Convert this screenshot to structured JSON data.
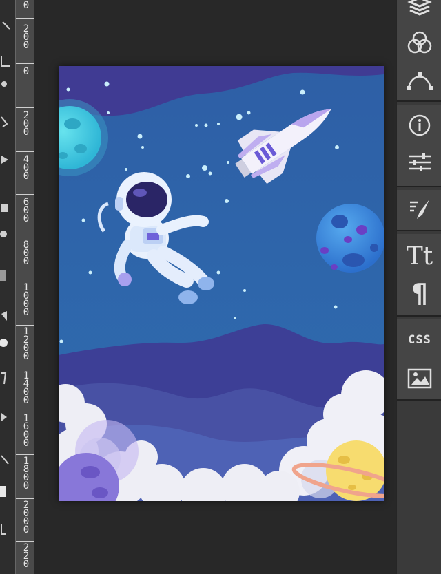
{
  "ruler": {
    "labels": [
      "0",
      "2\n0\n0",
      "0",
      "2\n0\n0",
      "4\n0\n0",
      "6\n0\n0",
      "8\n0\n0",
      "1\n0\n0\n0",
      "1\n2\n0\n0",
      "1\n4\n0\n0",
      "1\n6\n0\n0",
      "1\n8\n0\n0",
      "2\n0\n0\n0",
      "2\n2\n0"
    ]
  },
  "panel": {
    "icons": [
      "layers-icon",
      "channels-icon",
      "paths-icon",
      "info-icon",
      "adjustments-icon",
      "brush-settings-icon",
      "character-icon",
      "paragraph-icon",
      "css-icon",
      "image-icon"
    ],
    "character_label": "Tt",
    "paragraph_label": "¶",
    "css_label": "CSS"
  },
  "colors": {
    "background": "#282828",
    "ruler": "#4a4a4a",
    "panel": "#454545",
    "sky": "#2f67a8",
    "nebula": "#403b93",
    "clouds": "#eeeef5",
    "yellow_planet": "#f7dc6f",
    "teal_planet": "#52d5e6",
    "blue_planet": "#3b8ee0"
  }
}
